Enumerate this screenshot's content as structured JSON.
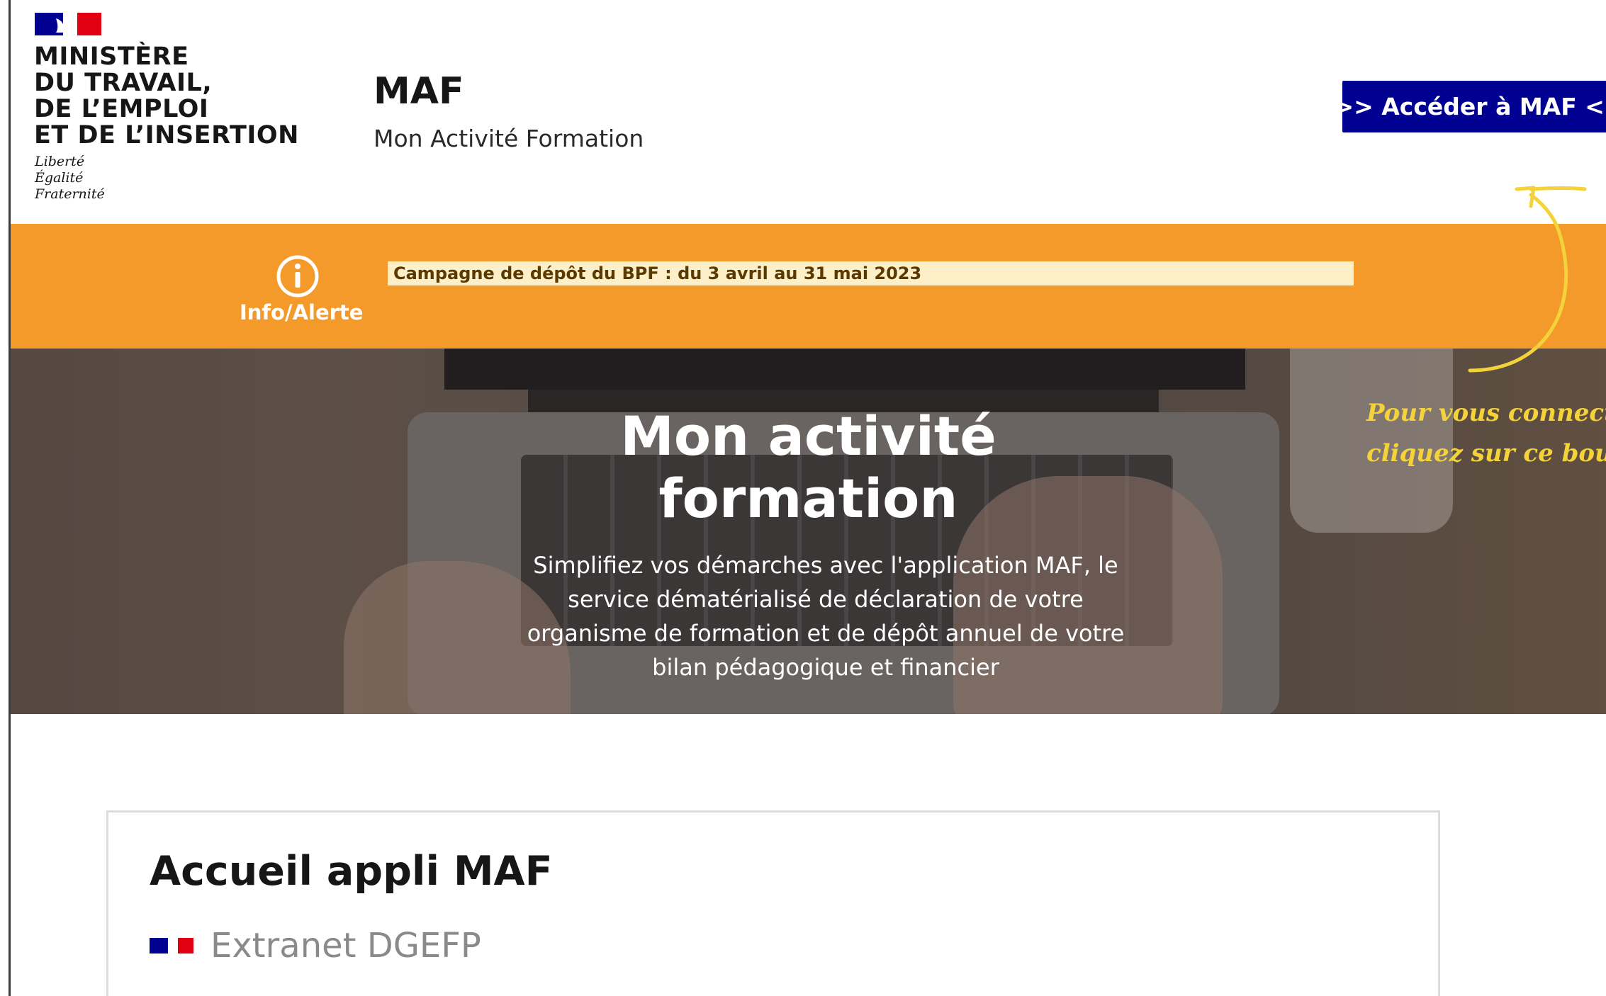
{
  "header": {
    "ministry_lines": [
      "MINISTÈRE",
      "DU TRAVAIL,",
      "DE L’EMPLOI",
      "ET DE L’INSERTION"
    ],
    "motto_lines": [
      "Liberté",
      "Égalité",
      "Fraternité"
    ],
    "site_title": "MAF",
    "site_tagline": "Mon Activité Formation",
    "cta_label": ">> Accéder à MAF <<"
  },
  "alert": {
    "label": "Info/Alerte",
    "message": "Campagne de dépôt du BPF : du 3 avril au 31 mai 2023"
  },
  "hero": {
    "title_lines": [
      "Mon activité",
      "formation"
    ],
    "text": "Simplifiez vos démarches avec l'application MAF, le service dématérialisé de déclaration de votre organisme de formation et de dépôt annuel de votre bilan pédagogique et financier"
  },
  "note": {
    "lines": [
      "Pour vous connecter",
      "cliquez sur ce bouton"
    ]
  },
  "card": {
    "title": "Accueil appli MAF",
    "subtitle": "Extranet DGEFP"
  },
  "colors": {
    "brand_blue": "#000091",
    "brand_red": "#e1000f",
    "alert_orange": "#f49a2a",
    "alert_message_bg": "#fdefc8",
    "note_yellow": "#f3d23a"
  }
}
